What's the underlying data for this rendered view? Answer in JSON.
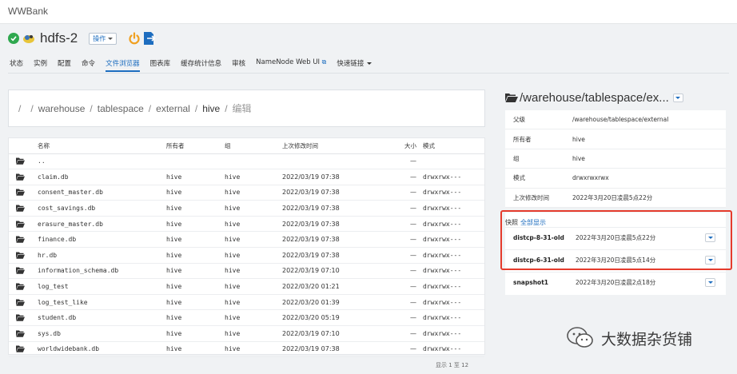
{
  "app": {
    "brand": "WWBank"
  },
  "service": {
    "name": "hdfs-2",
    "ops_label": "操作",
    "icons": [
      "check-circle-icon",
      "hdfs-service-icon",
      "power-icon",
      "export-file-icon"
    ]
  },
  "tabs": [
    {
      "label": "状态"
    },
    {
      "label": "实例"
    },
    {
      "label": "配置"
    },
    {
      "label": "命令"
    },
    {
      "label": "文件浏览器",
      "active": true
    },
    {
      "label": "图表库"
    },
    {
      "label": "缓存统计信息"
    },
    {
      "label": "审核"
    },
    {
      "label": "NameNode Web UI",
      "external": true
    },
    {
      "label": "快速链接",
      "dropdown": true
    }
  ],
  "breadcrumb": {
    "root": "/",
    "items": [
      "warehouse",
      "tablespace",
      "external"
    ],
    "current": "hive",
    "edit": "编辑"
  },
  "table": {
    "headers": {
      "name": "名称",
      "owner": "所有者",
      "group": "组",
      "modified": "上次修改时间",
      "size": "大小",
      "mode": "模式"
    },
    "rows": [
      {
        "name": "..",
        "owner": "",
        "group": "",
        "modified": "",
        "size": "—",
        "mode": ""
      },
      {
        "name": "claim.db",
        "owner": "hive",
        "group": "hive",
        "modified": "2022/03/19 07:38",
        "size": "—",
        "mode": "drwxrwx---"
      },
      {
        "name": "consent_master.db",
        "owner": "hive",
        "group": "hive",
        "modified": "2022/03/19 07:38",
        "size": "—",
        "mode": "drwxrwx---"
      },
      {
        "name": "cost_savings.db",
        "owner": "hive",
        "group": "hive",
        "modified": "2022/03/19 07:38",
        "size": "—",
        "mode": "drwxrwx---"
      },
      {
        "name": "erasure_master.db",
        "owner": "hive",
        "group": "hive",
        "modified": "2022/03/19 07:38",
        "size": "—",
        "mode": "drwxrwx---"
      },
      {
        "name": "finance.db",
        "owner": "hive",
        "group": "hive",
        "modified": "2022/03/19 07:38",
        "size": "—",
        "mode": "drwxrwx---"
      },
      {
        "name": "hr.db",
        "owner": "hive",
        "group": "hive",
        "modified": "2022/03/19 07:38",
        "size": "—",
        "mode": "drwxrwx---"
      },
      {
        "name": "information_schema.db",
        "owner": "hive",
        "group": "hive",
        "modified": "2022/03/19 07:10",
        "size": "—",
        "mode": "drwxrwx---"
      },
      {
        "name": "log_test",
        "owner": "hive",
        "group": "hive",
        "modified": "2022/03/20 01:21",
        "size": "—",
        "mode": "drwxrwx---"
      },
      {
        "name": "log_test_like",
        "owner": "hive",
        "group": "hive",
        "modified": "2022/03/20 01:39",
        "size": "—",
        "mode": "drwxrwx---"
      },
      {
        "name": "student.db",
        "owner": "hive",
        "group": "hive",
        "modified": "2022/03/20 05:19",
        "size": "—",
        "mode": "drwxrwx---"
      },
      {
        "name": "sys.db",
        "owner": "hive",
        "group": "hive",
        "modified": "2022/03/19 07:10",
        "size": "—",
        "mode": "drwxrwx---"
      },
      {
        "name": "worldwidebank.db",
        "owner": "hive",
        "group": "hive",
        "modified": "2022/03/19 07:38",
        "size": "—",
        "mode": "drwxrwx---"
      }
    ],
    "pager": "显示 1 至 12"
  },
  "details": {
    "title": "/warehouse/tablespace/ex...",
    "props": [
      {
        "key": "父级",
        "value": "/warehouse/tablespace/external"
      },
      {
        "key": "所有者",
        "value": "hive"
      },
      {
        "key": "组",
        "value": "hive"
      },
      {
        "key": "模式",
        "value": "drwxrwxrwx"
      },
      {
        "key": "上次修改时间",
        "value": "2022年3月20日凌晨5点22分"
      }
    ]
  },
  "snapshots": {
    "heading": "快照",
    "show_all": "全部显示",
    "items": [
      {
        "name": "distcp-8-31-old",
        "date": "2022年3月20日凌晨5点22分"
      },
      {
        "name": "distcp-6-31-old",
        "date": "2022年3月20日凌晨5点14分"
      },
      {
        "name": "snapshot1",
        "date": "2022年3月20日凌晨2点18分"
      }
    ]
  },
  "watermark": {
    "text": "大数据杂货铺"
  },
  "colors": {
    "accent": "#1d6dbf",
    "ok": "#2fa84f",
    "power": "#f0a020",
    "highlight": "#e53b2c"
  }
}
